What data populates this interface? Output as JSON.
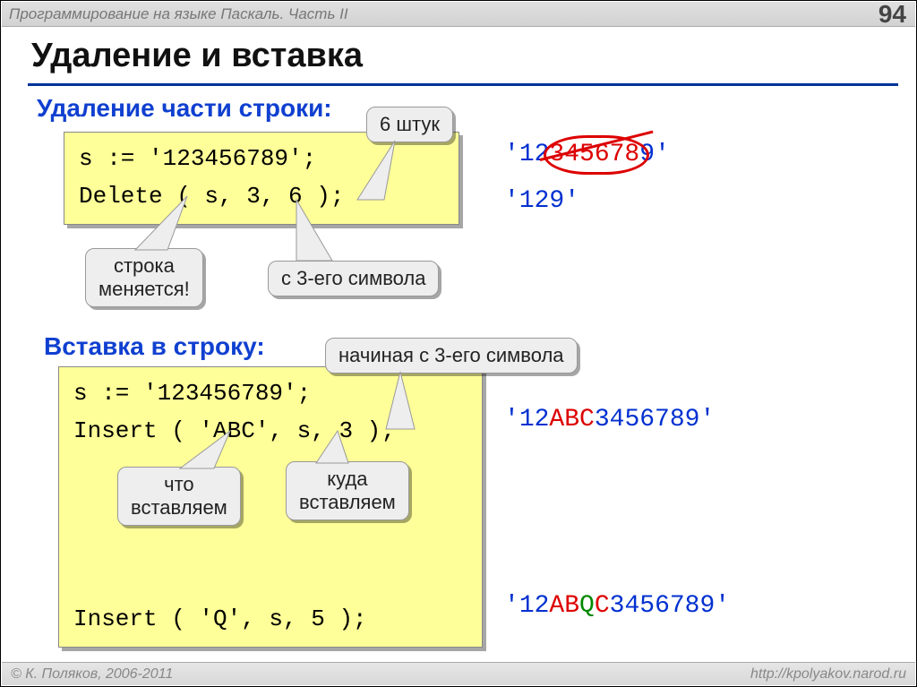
{
  "header": {
    "title": "Программирование на языке Паскаль. Часть II",
    "page": "94"
  },
  "footer": {
    "left": "© К. Поляков, 2006-2011",
    "right": "http://kpolyakov.narod.ru"
  },
  "slide_title": "Удаление и вставка",
  "section1": {
    "heading": "Удаление части строки:",
    "code": "s := '123456789';\nDelete ( s, 3, 6 );",
    "callout_count": "6 штук",
    "callout_varchanges": "строка\nменяется!",
    "callout_fromchar": "с 3-его символа",
    "result_before_q1": "'",
    "result_before_keep": "12",
    "result_before_strike": "345678",
    "result_before_keep2": "9",
    "result_before_q2": "'",
    "result_after": "'129'"
  },
  "section2": {
    "heading": "Вставка в строку:",
    "code": "s := '123456789';\nInsert ( 'ABC', s, 3 );\n\n\n\n\nInsert ( 'Q', s, 5 );",
    "callout_start": "начиная с 3-его символа",
    "callout_what": "что\nвставляем",
    "callout_where": "куда\nвставляем",
    "res1_q1": "'",
    "res1_a": "12",
    "res1_b": "ABC",
    "res1_c": "3456789",
    "res1_q2": "'",
    "res2_q1": "'",
    "res2_a": "12",
    "res2_b": "AB",
    "res2_q": "Q",
    "res2_c": "C",
    "res2_d": "3456789",
    "res2_q2": "'"
  }
}
